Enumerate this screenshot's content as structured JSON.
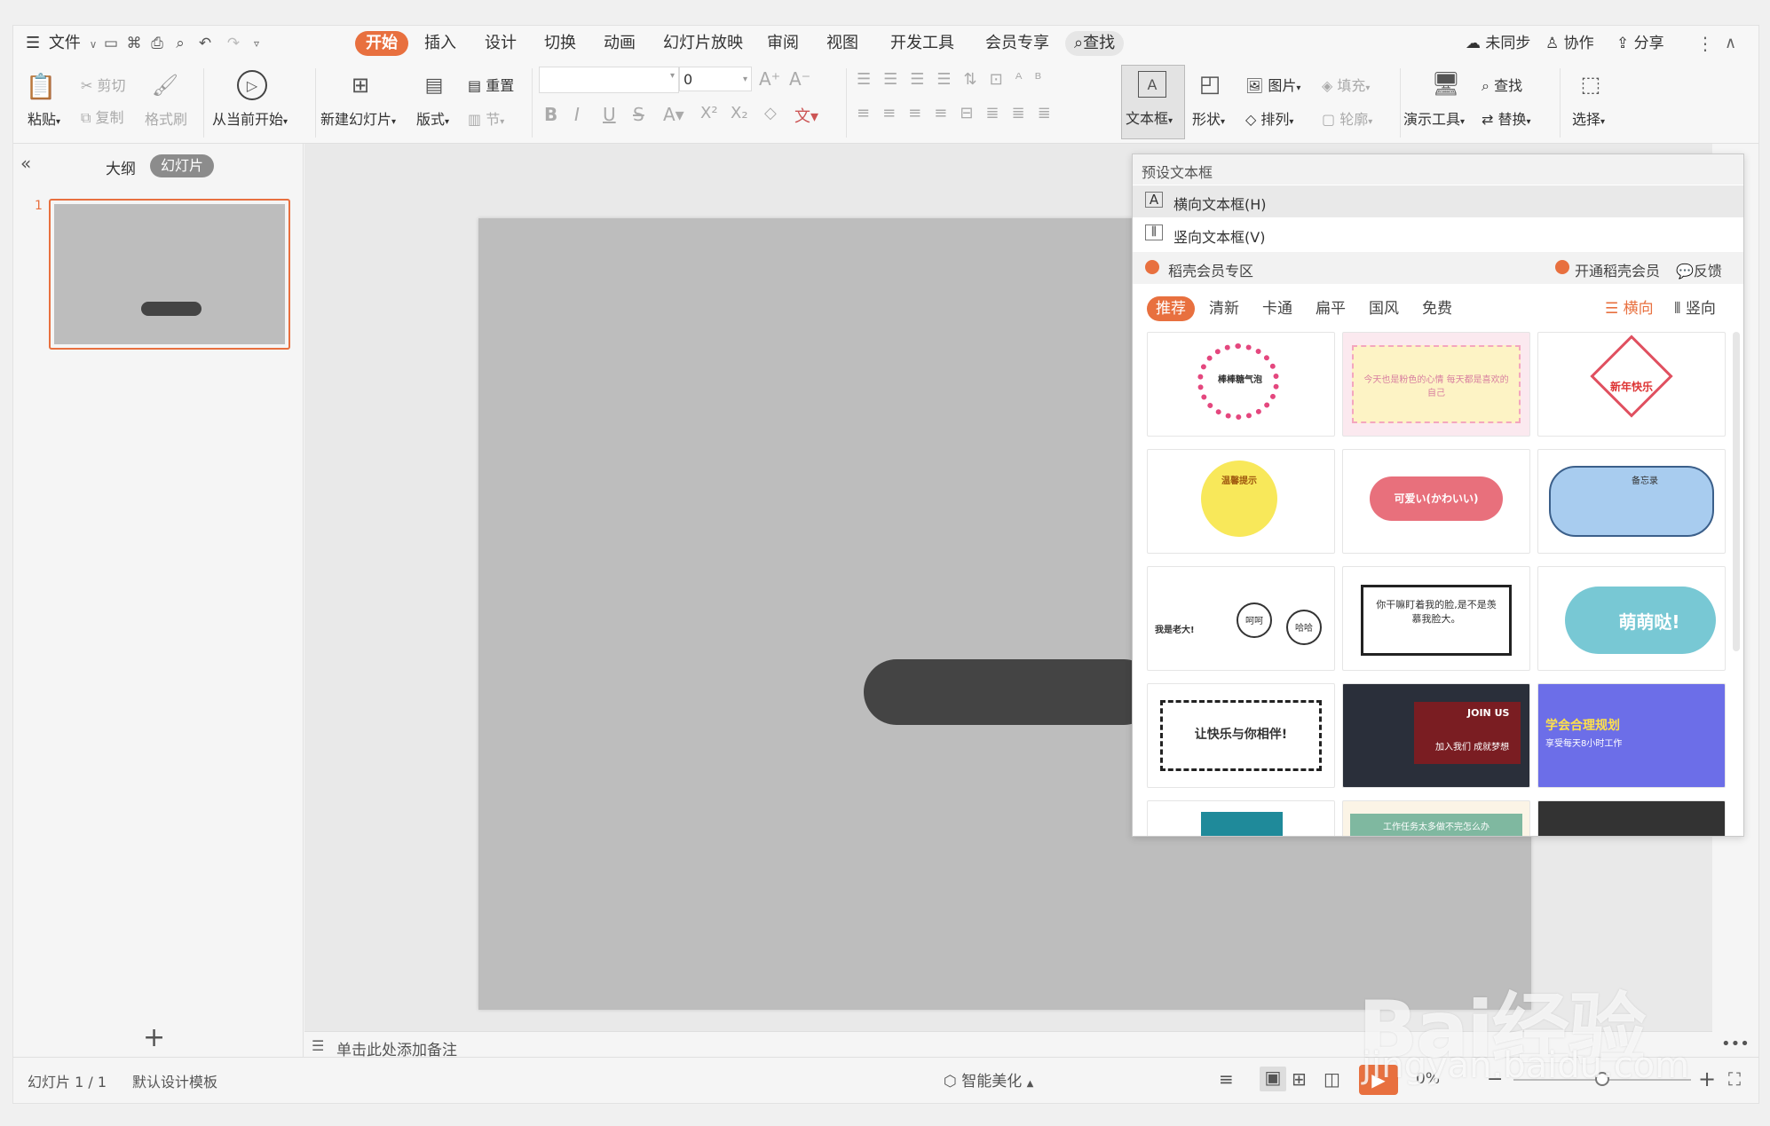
{
  "menu": {
    "file_label": "文件",
    "tabs": [
      "开始",
      "插入",
      "设计",
      "切换",
      "动画",
      "幻灯片放映",
      "审阅",
      "视图",
      "开发工具",
      "会员专享"
    ],
    "search_label": "查找",
    "unsynced_label": "未同步",
    "collab_label": "协作",
    "share_label": "分享"
  },
  "ribbon": {
    "paste": "粘贴",
    "cut": "剪切",
    "copy": "复制",
    "format_painter": "格式刷",
    "from_current": "从当前开始",
    "new_slide": "新建幻灯片",
    "layout": "版式",
    "reset": "重置",
    "section": "节",
    "font_size_value": "0",
    "textbox": "文本框",
    "shape": "形状",
    "picture": "图片",
    "fill": "填充",
    "arrange": "排列",
    "outline": "轮廓",
    "present_tools": "演示工具",
    "find": "查找",
    "replace": "替换",
    "select": "选择"
  },
  "left_panel": {
    "outline_tab": "大纲",
    "slides_tab": "幻灯片",
    "slide_number": "1"
  },
  "notes_placeholder": "单击此处添加备注",
  "status": {
    "slide_info": "幻灯片 1 / 1",
    "template": "默认设计模板",
    "beautify": "智能美化",
    "zoom": "0%"
  },
  "dropdown": {
    "preset_header": "预设文本框",
    "horizontal_textbox": "横向文本框(H)",
    "vertical_textbox": "竖向文本框(V)",
    "member_zone": "稻壳会员专区",
    "open_member": "开通稻壳会员",
    "feedback": "反馈",
    "gallery_tabs": [
      "推荐",
      "清新",
      "卡通",
      "扁平",
      "国风",
      "免费"
    ],
    "orient_horizontal": "横向",
    "orient_vertical": "竖向",
    "thumbs": [
      {
        "text": "棒棒糖气泡"
      },
      {
        "text": "今天也是粉色的心情 每天都是喜欢的自己"
      },
      {
        "text": "新年快乐"
      },
      {
        "text": "温馨提示"
      },
      {
        "text": "可爱い(かわいい)"
      },
      {
        "text": "备忘录"
      },
      {
        "text": "我是老大!",
        "text2": "呵呵",
        "text3": "哈哈"
      },
      {
        "text": "你干嘛盯着我的脸,是不是羡慕我脸大。"
      },
      {
        "text": "萌萌哒!"
      },
      {
        "text": "让快乐与你相伴!"
      },
      {
        "text": "JOIN US",
        "text2": "加入我们 成就梦想"
      },
      {
        "text": "学会合理规划",
        "text2": "享受每天8小时工作"
      },
      {
        "text": ""
      },
      {
        "text": "工作任务太多做不完怎么办"
      },
      {
        "text": ""
      }
    ]
  },
  "watermark": {
    "brand": "Bai经验",
    "url": "jingyan.baidu.com"
  },
  "colors": {
    "accent": "#e8703f",
    "slide_bg": "#bdbdbd",
    "shape": "#444444"
  }
}
